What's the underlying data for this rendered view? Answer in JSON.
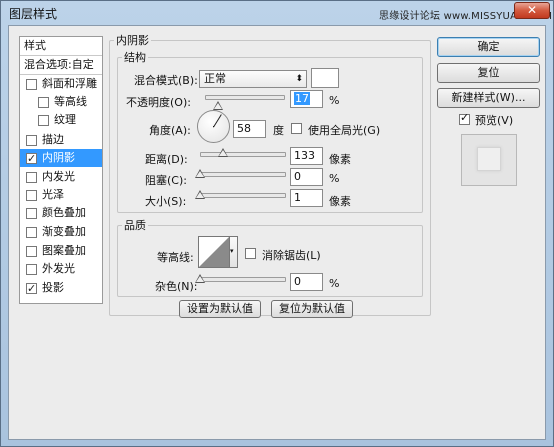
{
  "window": {
    "title": "图层样式",
    "watermark": "思缘设计论坛  www.MISSYUAN.COM",
    "close_label": "✕"
  },
  "style_list": {
    "header": "样式",
    "blend_options": "混合选项:自定",
    "items": [
      {
        "label": "斜面和浮雕",
        "checked": false
      },
      {
        "label": "等高线",
        "checked": false
      },
      {
        "label": "纹理",
        "checked": false
      },
      {
        "label": "描边",
        "checked": false
      },
      {
        "label": "内阴影",
        "checked": true,
        "selected": true
      },
      {
        "label": "内发光",
        "checked": false
      },
      {
        "label": "光泽",
        "checked": false
      },
      {
        "label": "颜色叠加",
        "checked": false
      },
      {
        "label": "渐变叠加",
        "checked": false
      },
      {
        "label": "图案叠加",
        "checked": false
      },
      {
        "label": "外发光",
        "checked": false
      },
      {
        "label": "投影",
        "checked": true
      }
    ]
  },
  "buttons": {
    "ok": "确定",
    "reset": "复位",
    "new_style": "新建样式(W)...",
    "preview_label": "预览(V)",
    "preview_checked": true,
    "make_default": "设置为默认值",
    "reset_default": "复位为默认值"
  },
  "inner_shadow": {
    "group_title": "内阴影",
    "structure_title": "结构",
    "blend_mode_label": "混合模式(B):",
    "blend_mode_value": "正常",
    "blend_color": "#ffffff",
    "opacity_label": "不透明度(O):",
    "opacity_value": "17",
    "opacity_unit": "%",
    "angle_label": "角度(A):",
    "angle_value": "58",
    "angle_unit": "度",
    "global_light_label": "使用全局光(G)",
    "global_light_checked": false,
    "distance_label": "距离(D):",
    "distance_value": "133",
    "distance_unit": "像素",
    "choke_label": "阻塞(C):",
    "choke_value": "0",
    "choke_unit": "%",
    "size_label": "大小(S):",
    "size_value": "1",
    "size_unit": "像素",
    "quality_title": "品质",
    "contour_label": "等高线:",
    "antialias_label": "消除锯齿(L)",
    "antialias_checked": false,
    "noise_label": "杂色(N):",
    "noise_value": "0",
    "noise_unit": "%"
  },
  "slider_levels": {
    "opacity": 0.17,
    "distance": 0.27,
    "choke": 0.0,
    "size": 0.004,
    "noise": 0.0
  }
}
